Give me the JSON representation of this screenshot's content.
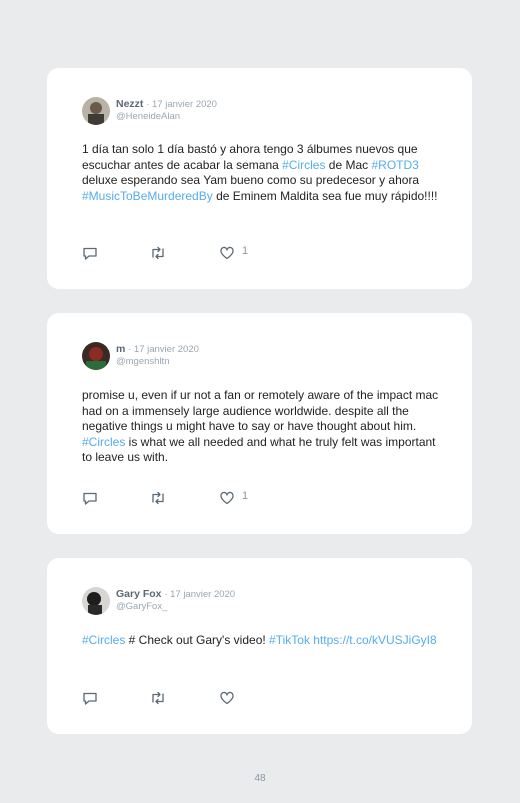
{
  "tweets": [
    {
      "name": "Nezzt",
      "date": "· 17 janvier 2020",
      "handle": "@HeneideAlan",
      "segments": [
        {
          "t": "1 día tan solo 1 día bastó y ahora tengo 3 álbumes nuevos que escuchar antes de acabar la semana ",
          "tag": false
        },
        {
          "t": "#Circles",
          "tag": true
        },
        {
          "t": " de Mac ",
          "tag": false
        },
        {
          "t": "#ROTD3",
          "tag": true
        },
        {
          "t": " deluxe esperando sea Yam bueno como su predecesor y ahora ",
          "tag": false
        },
        {
          "t": "#MusicToBeMurderedBy",
          "tag": true
        },
        {
          "t": " de Eminem Maldita sea fue muy rápido!!!!",
          "tag": false
        }
      ],
      "likes": "1"
    },
    {
      "name": "m",
      "date": "· 17 janvier 2020",
      "handle": "@mgenshltn",
      "segments": [
        {
          "t": "promise u, even if ur not a fan or remotely aware of the impact mac had on a immensely large audience worldwide. despite all the negative things u might have to say or have thought about him. ",
          "tag": false
        },
        {
          "t": "#Circles",
          "tag": true
        },
        {
          "t": " is what we all needed and what he truly felt was important to leave us with.",
          "tag": false
        }
      ],
      "likes": "1"
    },
    {
      "name": "Gary Fox",
      "date": "· 17 janvier 2020",
      "handle": "@GaryFox_",
      "segments": [
        {
          "t": "#Circles",
          "tag": true
        },
        {
          "t": " # Check out Gary's video! ",
          "tag": false
        },
        {
          "t": "#TikTok",
          "tag": true
        },
        {
          "t": " https://t.co/kVUSJiGyI8",
          "tag": true
        }
      ],
      "likes": ""
    }
  ],
  "icons": {
    "reply": "reply-icon",
    "retweet": "retweet-icon",
    "like": "heart-icon"
  },
  "colors": {
    "hashtag": "#55acee",
    "background": "#e9ebed",
    "card": "#ffffff"
  },
  "page_number": "48"
}
